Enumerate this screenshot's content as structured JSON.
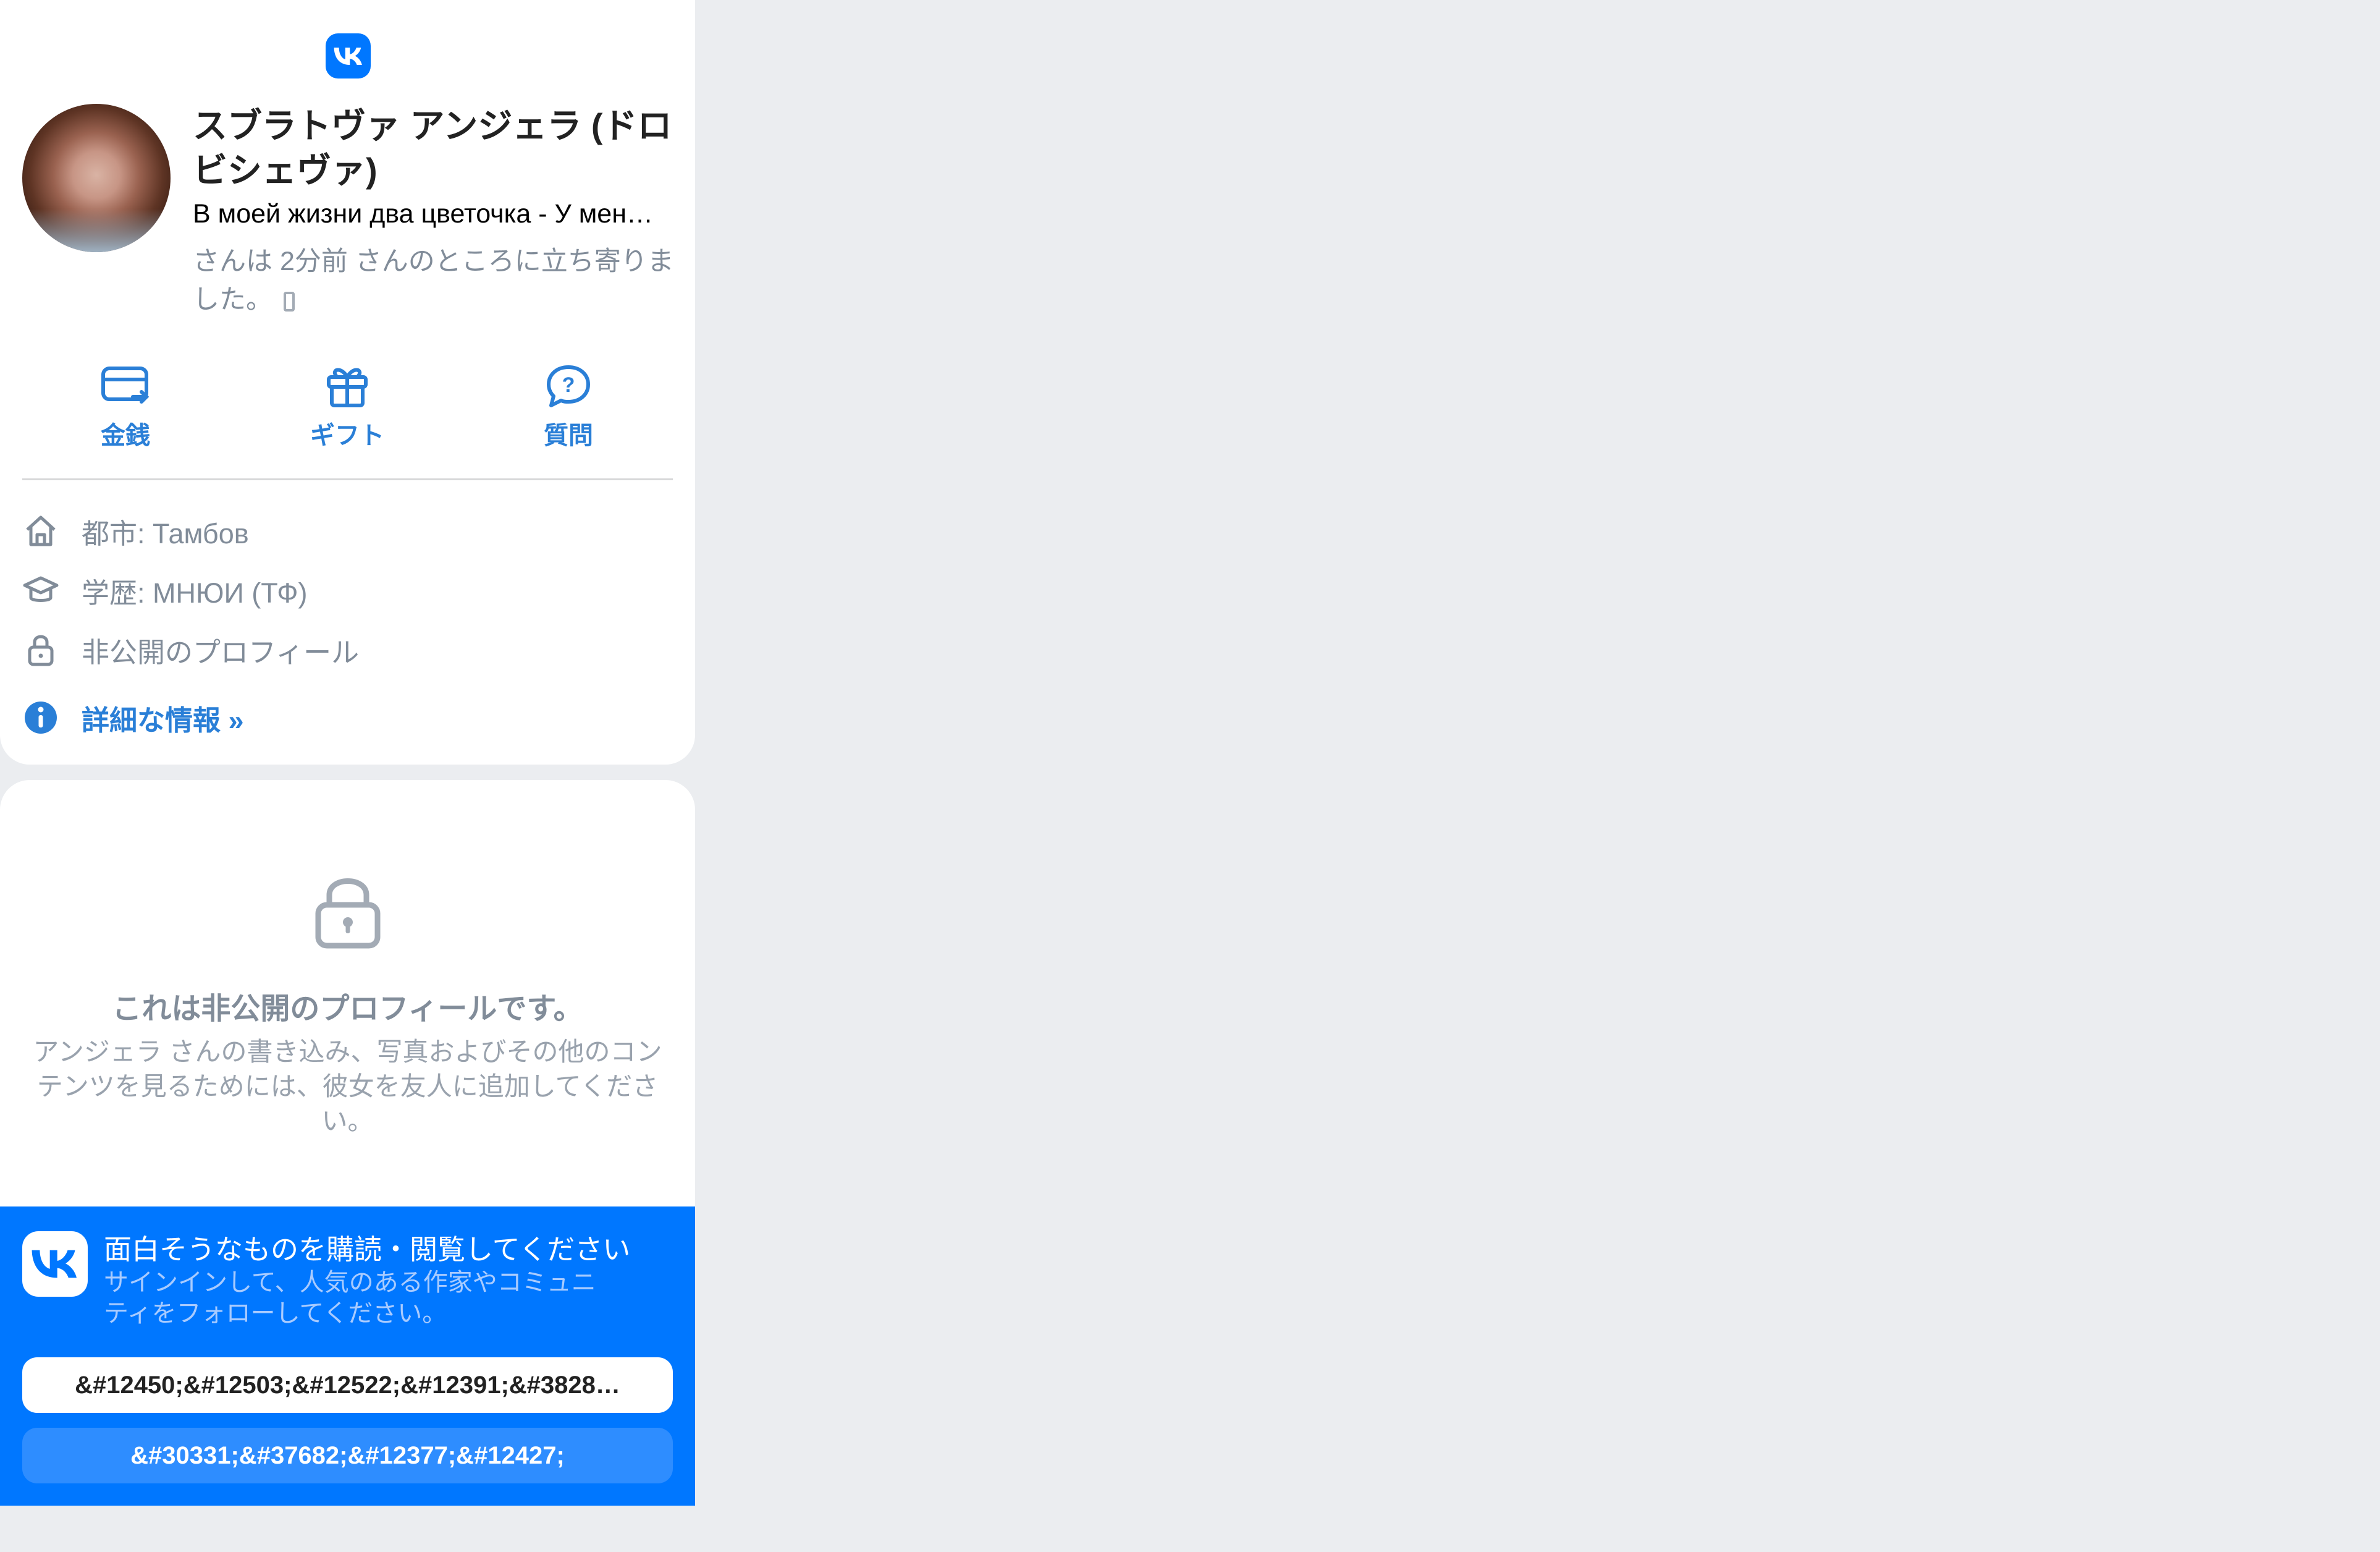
{
  "profile": {
    "name": "スブラトヴァ アンジェラ (ドロビシェヴァ)",
    "status": "В моей жизни два цветочка - У мен…",
    "visited": "さんは 2分前 さんのところに立ち寄りました。"
  },
  "actions": [
    {
      "label": "金銭",
      "icon": "card-icon"
    },
    {
      "label": "ギフト",
      "icon": "gift-icon"
    },
    {
      "label": "質問",
      "icon": "question-icon"
    }
  ],
  "info": {
    "city": "都市: Тамбов",
    "education": "学歴: МНЮИ (ТФ)",
    "privacy": "非公開のプロフィール",
    "more": "詳細な情報 »"
  },
  "private": {
    "title": "これは非公開のプロフィールです。",
    "description": "アンジェラ さんの書き込み、写真およびその他のコンテンツを見るためには、彼女を友人に追加してください。"
  },
  "banner": {
    "title": "面白そうなものを購読・閲覧してください",
    "subtitle": "サインインして、人気のある作家やコミュニティをフォローしてください。",
    "signup_label": "&#12450;&#12503;&#12522;&#12391;&#3828…",
    "login_label": "&#30331;&#37682;&#12377;&#12427;"
  },
  "colors": {
    "background": "#ebedf0",
    "accent": "#0077ff",
    "link": "#2a7fd7",
    "muted": "#818c99"
  }
}
